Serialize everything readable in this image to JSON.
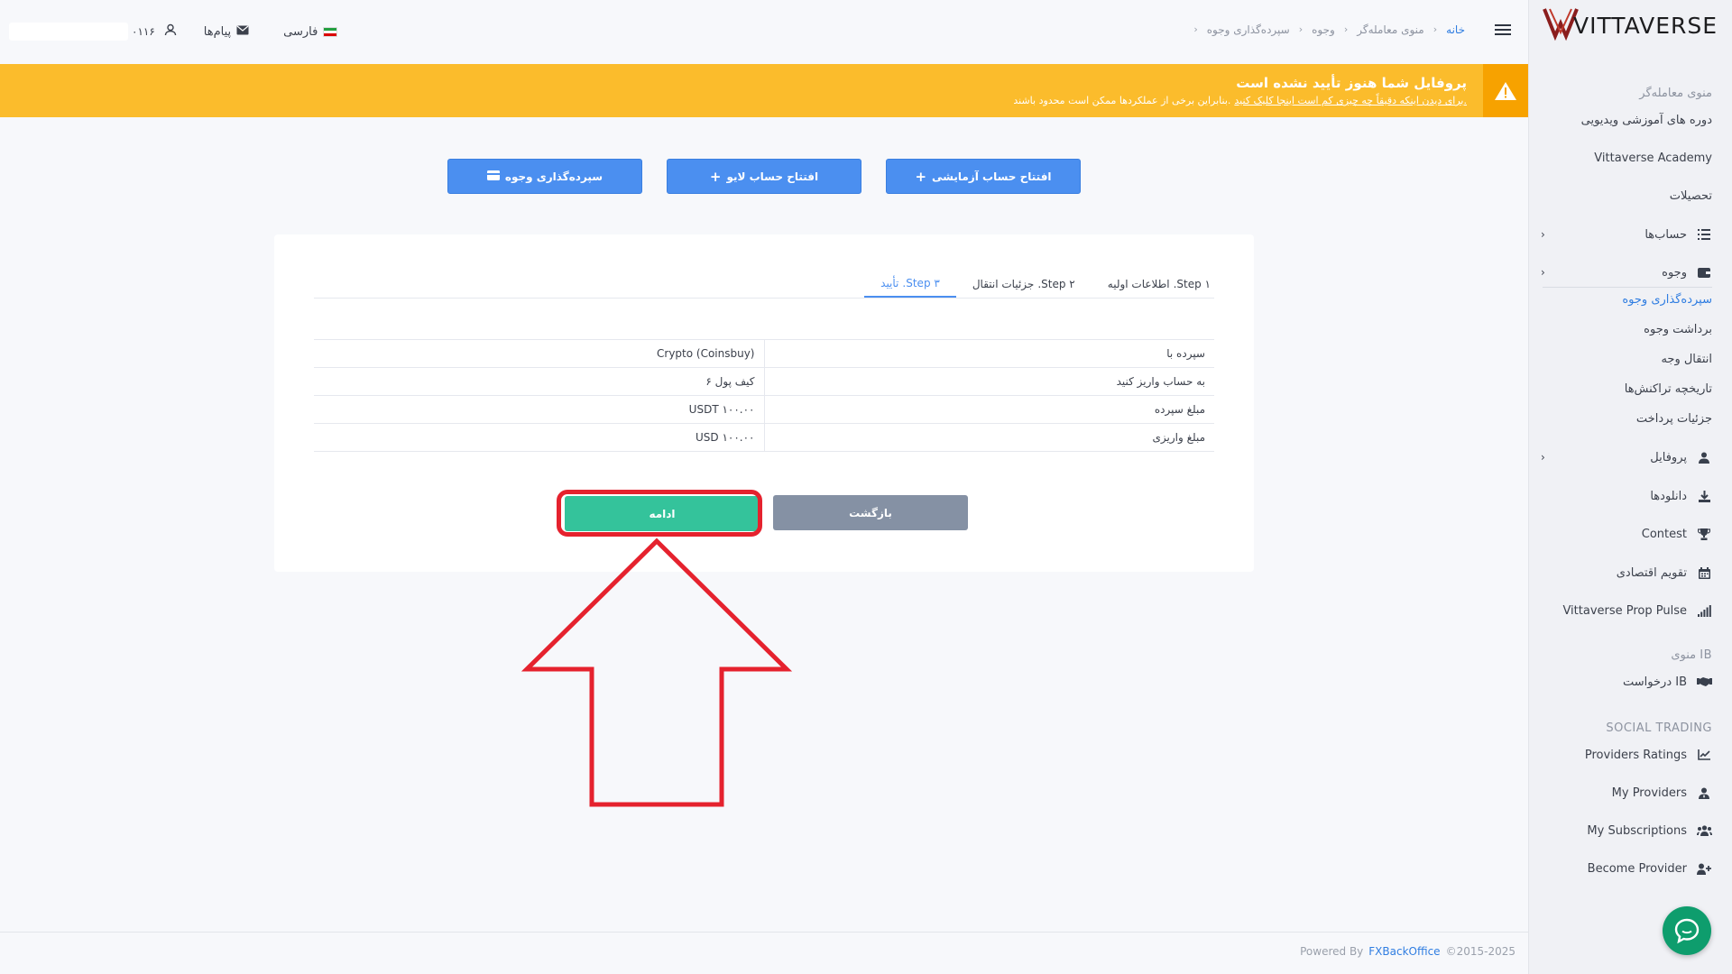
{
  "brand": {
    "name": "VITTAVERSE",
    "colors": {
      "accent": "#2f7de1",
      "warning": "#fbbc2c",
      "continue": "#34c39b",
      "back": "#8591a4",
      "highlight": "#e5222e"
    }
  },
  "sidebar": {
    "trader_menu_heading": "منوی معامله‌گر",
    "items": [
      {
        "label": "دوره های آموزشی ویدیویی"
      },
      {
        "label": "Vittaverse Academy"
      },
      {
        "label": "تحصیلات"
      },
      {
        "label": "حساب‌ها",
        "icon": "list-icon"
      },
      {
        "label": "وجوه",
        "icon": "wallet-icon"
      }
    ],
    "funds_sub": [
      {
        "label": "سپرده‌گذاری وجوه",
        "active": true
      },
      {
        "label": "برداشت وجوه"
      },
      {
        "label": "انتقال وجه"
      },
      {
        "label": "تاریخچه تراکنش‌ها"
      },
      {
        "label": "جزئیات پرداخت"
      }
    ],
    "items2": [
      {
        "label": "پروفایل",
        "icon": "user-icon"
      },
      {
        "label": "دانلودها",
        "icon": "download-icon"
      },
      {
        "label": "Contest",
        "icon": "trophy-icon"
      },
      {
        "label": "تقویم اقتصادی",
        "icon": "calendar-icon"
      },
      {
        "label": "Vittaverse Prop Pulse",
        "icon": "signal-bars-icon"
      }
    ],
    "ib_heading": "منوی IB",
    "ib_items": [
      {
        "label": "درخواست IB",
        "icon": "handshake-icon"
      }
    ],
    "social_heading": "SOCIAL TRADING",
    "social_items": [
      {
        "label": "Providers Ratings",
        "icon": "chart-line-icon"
      },
      {
        "label": "My Providers",
        "icon": "user-tie-icon"
      },
      {
        "label": "My Subscriptions",
        "icon": "users-icon"
      },
      {
        "label": "Become Provider",
        "icon": "user-plus-icon"
      }
    ]
  },
  "header": {
    "breadcrumb": [
      "خانه",
      "منوی معامله‌گر",
      "وجوه",
      "سپرده‌گذاری وجوه"
    ],
    "account_suffix": "۰۱۱۶",
    "messages_label": "پیام‌ها",
    "language_label": "فارسی"
  },
  "banner": {
    "title": "پروفایل شما هنوز تأیید نشده است",
    "text": "بنابراین برخی از عملکردها ممکن است محدود باشند.",
    "link_text": "برای دیدن اینکه دقیقاً چه چیزی کم است اینجا کلیک کنید."
  },
  "actions": {
    "demo": "افتتاح حساب آزمایشی",
    "live": "افتتاح حساب لایو",
    "deposit": "سپرده‌گذاری وجوه"
  },
  "steps": [
    {
      "num": "Step ۱.",
      "label": "اطلاعات اولیه"
    },
    {
      "num": "Step ۲.",
      "label": "جزئیات انتقال"
    },
    {
      "num": "Step ۳.",
      "label": "تأیید",
      "active": true
    }
  ],
  "summary": [
    {
      "label": "سپرده با",
      "value": "Crypto (Coinsbuy)"
    },
    {
      "label": "به حساب واریز کنید",
      "value": "کیف پول ۶"
    },
    {
      "label": "مبلغ سپرده",
      "value": "USDT ۱۰۰.۰۰"
    },
    {
      "label": "مبلغ واریزی",
      "value": "USD ۱۰۰.۰۰"
    }
  ],
  "buttons": {
    "continue": "ادامه",
    "back": "بازگشت"
  },
  "footer": {
    "powered": "Powered By",
    "brand": "FXBackOffice",
    "copyright": "©2015-2025"
  }
}
